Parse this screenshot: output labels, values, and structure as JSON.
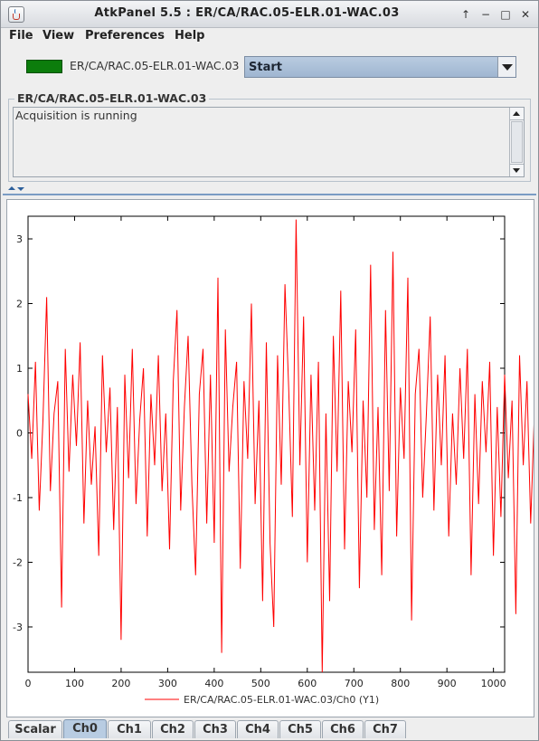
{
  "window": {
    "title": "AtkPanel  5.5  : ER/CA/RAC.05-ELR.01-WAC.03",
    "icon": "java-icon",
    "controls": [
      "maximize-icon",
      "minimize-icon",
      "restore-icon",
      "close-icon"
    ]
  },
  "menubar": {
    "items": [
      "File",
      "View",
      "Preferences",
      "Help"
    ]
  },
  "device": {
    "state_color": "#0c7d0c",
    "name": "ER/CA/RAC.05-ELR.01-WAC.03",
    "command_selected": "Start"
  },
  "status": {
    "title": "ER/CA/RAC.05-ELR.01-WAC.03",
    "text": "Acquisition is running"
  },
  "tabs": {
    "items": [
      "Scalar",
      "Ch0",
      "Ch1",
      "Ch2",
      "Ch3",
      "Ch4",
      "Ch5",
      "Ch6",
      "Ch7"
    ],
    "selected": "Ch0"
  },
  "chart_data": {
    "type": "line",
    "title": "",
    "xlabel": "",
    "ylabel": "",
    "xlim": [
      0,
      1024
    ],
    "ylim": [
      -3.7,
      3.35
    ],
    "xticks": [
      0,
      100,
      200,
      300,
      400,
      500,
      600,
      700,
      800,
      900,
      1000
    ],
    "yticks": [
      3,
      2,
      1,
      0,
      -1,
      -2,
      -3
    ],
    "grid": false,
    "legend_position": "bottom",
    "series": [
      {
        "name": "ER/CA/RAC.05-ELR.01-WAC.03/Ch0 (Y1)",
        "color": "#ff0000",
        "x_start": 0,
        "x_step": 8,
        "values": [
          0.6,
          -0.4,
          1.1,
          -1.2,
          0.2,
          2.1,
          -0.9,
          0.3,
          0.8,
          -2.7,
          1.3,
          -0.6,
          0.9,
          -0.2,
          1.4,
          -1.4,
          0.5,
          -0.8,
          0.1,
          -1.9,
          1.2,
          -0.3,
          0.7,
          -1.5,
          0.4,
          -3.2,
          0.9,
          -0.7,
          1.3,
          -1.1,
          0.2,
          1.0,
          -1.6,
          0.6,
          -0.5,
          1.2,
          -0.9,
          0.3,
          -1.8,
          0.8,
          1.9,
          -1.2,
          0.4,
          1.5,
          -0.8,
          -2.2,
          0.6,
          1.3,
          -1.4,
          0.9,
          -1.7,
          2.4,
          -3.4,
          1.6,
          -0.6,
          0.4,
          1.1,
          -2.1,
          0.8,
          -0.4,
          2.0,
          -1.1,
          0.5,
          -2.6,
          1.4,
          -1.7,
          -3.0,
          1.2,
          -0.8,
          2.3,
          0.7,
          -1.3,
          3.3,
          -0.5,
          1.8,
          -2.0,
          0.9,
          -1.2,
          1.1,
          -3.7,
          0.3,
          -2.6,
          1.5,
          -0.6,
          2.2,
          -1.8,
          0.8,
          -0.3,
          1.6,
          -2.4,
          0.5,
          -1.0,
          2.6,
          -1.5,
          0.4,
          -2.2,
          1.9,
          -0.9,
          2.8,
          -1.6,
          0.7,
          -0.4,
          2.4,
          -2.9,
          0.6,
          1.3,
          -1.0,
          0.3,
          1.8,
          -1.2,
          0.9,
          -0.5,
          1.2,
          -1.6,
          0.3,
          -0.8,
          1.0,
          -0.4,
          1.3,
          -2.2,
          0.6,
          -1.1,
          0.8,
          -0.3,
          1.1,
          -1.9,
          0.4,
          -1.3,
          0.9,
          -0.7,
          0.5,
          -2.8,
          1.2,
          -0.5,
          0.8,
          -1.4,
          0.3,
          1.1,
          -1.8,
          0.7
        ]
      }
    ]
  }
}
